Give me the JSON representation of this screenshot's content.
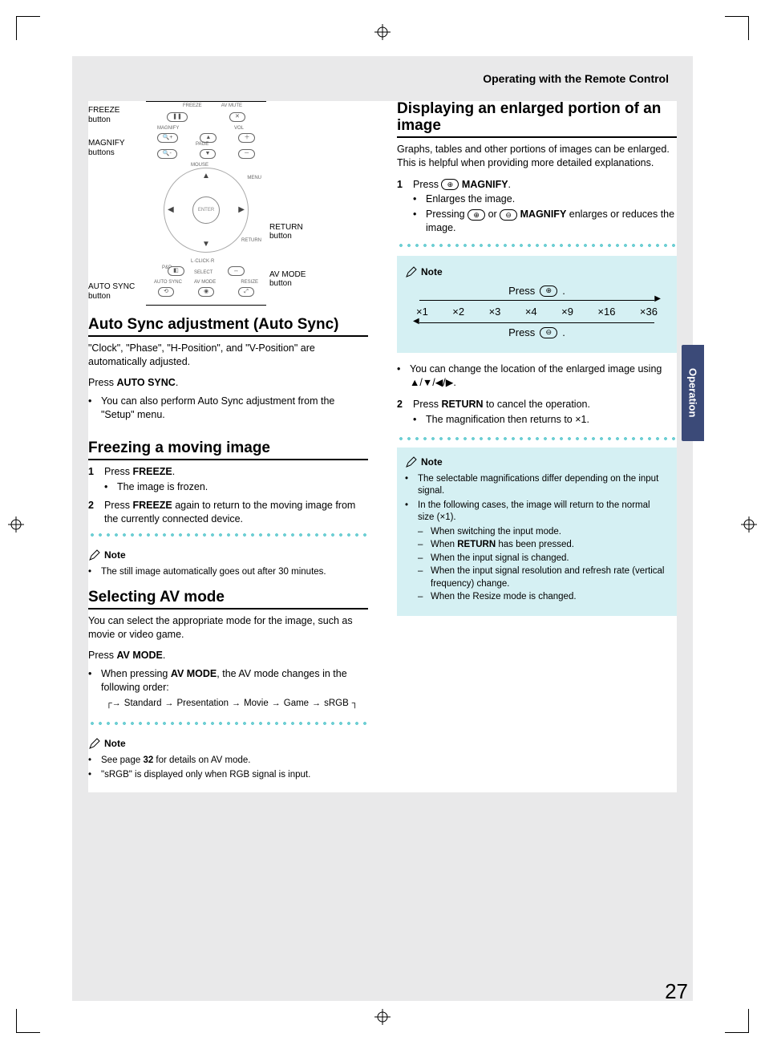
{
  "page_number": "27",
  "side_tab": "Operation",
  "breadcrumb": "Operating with the Remote Control",
  "diagram": {
    "labels_left": {
      "freeze": "FREEZE button",
      "magnify": "MAGNIFY buttons",
      "auto_sync": "AUTO SYNC button"
    },
    "labels_right": {
      "return": "RETURN button",
      "av_mode": "AV MODE button"
    },
    "mini": {
      "freeze": "FREEZE",
      "av_mute": "AV MUTE",
      "magnify": "MAGNIFY",
      "vol": "VOL",
      "page": "PAGE",
      "mouse": "MOUSE",
      "menu": "MENU",
      "enter": "ENTER",
      "return": "RETURN",
      "click_l": "L·CLICK·R",
      "pnp": "P&P",
      "select": "SELECT",
      "auto_sync": "AUTO SYNC",
      "av_mode": "AV MODE",
      "resize": "RESIZE"
    }
  },
  "sec_autosync": {
    "title": "Auto Sync adjustment (Auto Sync)",
    "body": "\"Clock\", \"Phase\", \"H-Position\", and \"V-Position\" are automatically adjusted.",
    "press_lead": "Press ",
    "press_b": "AUTO SYNC",
    "press_tail": ".",
    "bullet1": "You can also perform Auto Sync adjustment from the \"Setup\" menu."
  },
  "sec_freeze": {
    "title": "Freezing a moving image",
    "step1_lead": "Press ",
    "step1_b": "FREEZE",
    "step1_tail": ".",
    "step1_sub": "The image is frozen.",
    "step2_lead": "Press ",
    "step2_b": "FREEZE",
    "step2_tail": " again to return to the moving image from the currently connected device.",
    "note_label": "Note",
    "note1": "The still image automatically goes out after 30 minutes."
  },
  "sec_avmode": {
    "title": "Selecting AV mode",
    "body": "You can select the appropriate mode for the image, such as movie or video game.",
    "press_lead": "Press ",
    "press_b": "AV MODE",
    "press_tail": ".",
    "bullet1_lead": "When pressing ",
    "bullet1_b": "AV MODE",
    "bullet1_tail": ", the AV mode changes in the following order:",
    "flow": [
      "Standard",
      "Presentation",
      "Movie",
      "Game",
      "sRGB"
    ],
    "note_label": "Note",
    "note1_lead": "See page ",
    "note1_b": "32",
    "note1_tail": " for details on AV mode.",
    "note2": "\"sRGB\" is displayed only when RGB signal is input."
  },
  "sec_magnify": {
    "title": "Displaying an enlarged portion of an image",
    "body": "Graphs, tables and other portions of images can be enlarged. This is helpful when providing more detailed explanations.",
    "step1_lead": "Press ",
    "step1_icon": "⊕",
    "step1_b": " MAGNIFY",
    "step1_tail": ".",
    "step1_sub1": "Enlarges the image.",
    "step1_sub2_lead": "Pressing ",
    "step1_sub2_icon1": "⊕",
    "step1_sub2_mid": " or ",
    "step1_sub2_icon2": "⊖",
    "step1_sub2_b": " MAGNIFY",
    "step1_sub2_tail": " enlarges or reduces the image.",
    "mag_note_label": "Note",
    "mag_press_plus": "Press ",
    "mag_press_plus_icon": "⊕",
    "mag_press_plus_tail": ".",
    "mag_vals": [
      "×1",
      "×2",
      "×3",
      "×4",
      "×9",
      "×16",
      "×36"
    ],
    "mag_press_minus": "Press ",
    "mag_press_minus_icon": "⊖",
    "mag_press_minus_tail": ".",
    "after_bullet": "You can change the location of the enlarged image using ▲/▼/◀/▶.",
    "step2_lead": "Press ",
    "step2_b": "RETURN",
    "step2_tail": " to cancel the operation.",
    "step2_sub": "The magnification then returns to ×1.",
    "note2_label": "Note",
    "note2_b1": "The selectable magnifications differ depending on the input signal.",
    "note2_b2": "In the following cases, the image will return to the normal size (×1).",
    "note2_d1": "When switching the input mode.",
    "note2_d2_lead": "When ",
    "note2_d2_b": "RETURN",
    "note2_d2_tail": " has been pressed.",
    "note2_d3": "When the input signal is changed.",
    "note2_d4": "When the input signal resolution and refresh rate (vertical frequency) change.",
    "note2_d5": "When the Resize mode is changed."
  }
}
